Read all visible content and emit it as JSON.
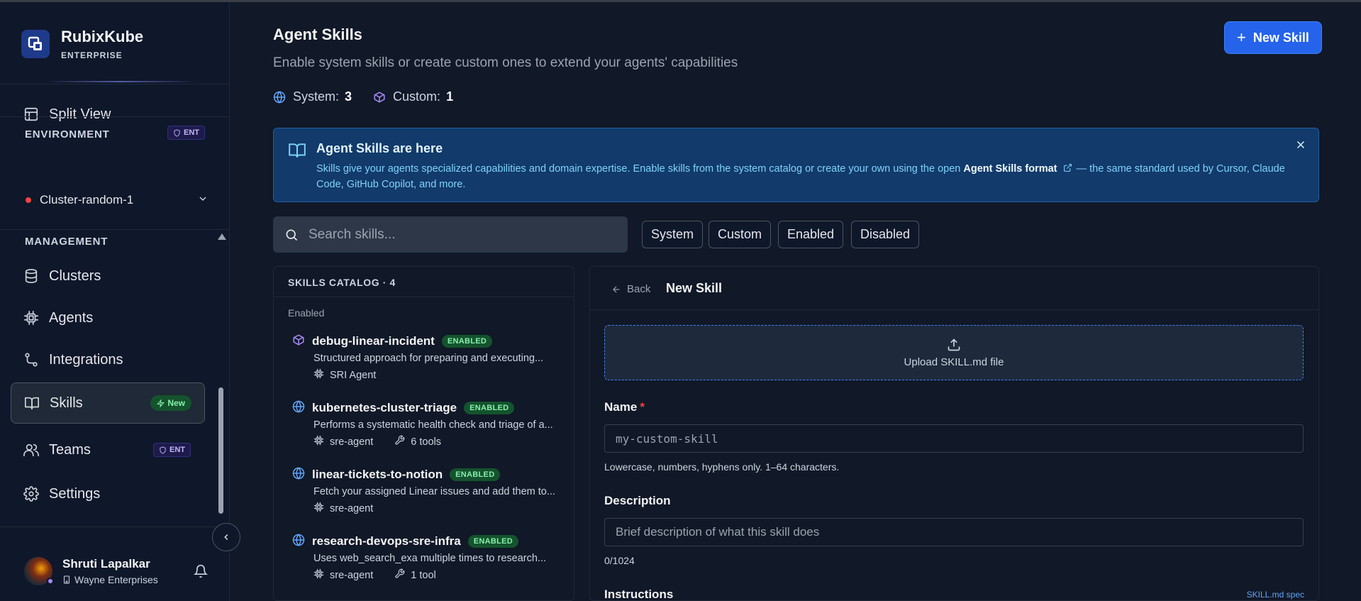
{
  "brand": {
    "name": "RubixKube",
    "tier": "ENTERPRISE"
  },
  "sidebar": {
    "split_view": "Split View",
    "environment_label": "ENVIRONMENT",
    "ent_badge": "ENT",
    "cluster": "Cluster-random-1",
    "management_label": "MANAGEMENT",
    "items": [
      {
        "label": "Clusters",
        "icon": "database-icon"
      },
      {
        "label": "Agents",
        "icon": "cpu-icon"
      },
      {
        "label": "Integrations",
        "icon": "route-icon"
      },
      {
        "label": "Skills",
        "icon": "book-open-icon",
        "badge": "New",
        "active": true
      },
      {
        "label": "Teams",
        "icon": "users-icon",
        "badge": "ENT"
      },
      {
        "label": "Settings",
        "icon": "gear-icon"
      }
    ],
    "user": {
      "name": "Shruti Lapalkar",
      "org": "Wayne Enterprises"
    }
  },
  "header": {
    "title": "Agent Skills",
    "subtitle": "Enable system skills or create custom ones to extend your agents' capabilities",
    "system_label": "System:",
    "system_count": "3",
    "custom_label": "Custom:",
    "custom_count": "1",
    "new_skill_button": "New Skill"
  },
  "banner": {
    "title": "Agent Skills are here",
    "text_before": "Skills give your agents specialized capabilities and domain expertise. Enable skills from the system catalog or create your own using the open ",
    "link": "Agent Skills format",
    "text_after": " — the same standard used by Cursor, Claude Code, GitHub Copilot, and more."
  },
  "search": {
    "placeholder": "Search skills..."
  },
  "filters": [
    "System",
    "Custom",
    "Enabled",
    "Disabled"
  ],
  "catalog": {
    "title": "SKILLS CATALOG · 4",
    "group": "Enabled",
    "skills": [
      {
        "name": "debug-linear-incident",
        "badge": "ENABLED",
        "icon": "cube-icon",
        "desc": "Structured approach for preparing and executing...",
        "agent": "SRI Agent",
        "tools": ""
      },
      {
        "name": "kubernetes-cluster-triage",
        "badge": "ENABLED",
        "icon": "globe-icon",
        "desc": "Performs a systematic health check and triage of a...",
        "agent": "sre-agent",
        "tools": "6 tools"
      },
      {
        "name": "linear-tickets-to-notion",
        "badge": "ENABLED",
        "icon": "globe-icon",
        "desc": "Fetch your assigned Linear issues and add them to...",
        "agent": "sre-agent",
        "tools": ""
      },
      {
        "name": "research-devops-sre-infra",
        "badge": "ENABLED",
        "icon": "globe-icon",
        "desc": "Uses web_search_exa multiple times to research...",
        "agent": "sre-agent",
        "tools": "1 tool"
      }
    ]
  },
  "form": {
    "back": "Back",
    "title": "New Skill",
    "upload_label": "Upload SKILL.md file",
    "name_label": "Name",
    "name_required": "*",
    "name_placeholder": "my-custom-skill",
    "name_help": "Lowercase, numbers, hyphens only. 1–64 characters.",
    "description_label": "Description",
    "description_placeholder": "Brief description of what this skill does",
    "description_count": "0/1024",
    "instructions_label": "Instructions",
    "spec_link": "SKILL.md spec"
  },
  "colors": {
    "accent": "#2563eb",
    "enabled": "#86efac",
    "banner_bg": "#123a6a",
    "purple": "#a78bfa"
  }
}
